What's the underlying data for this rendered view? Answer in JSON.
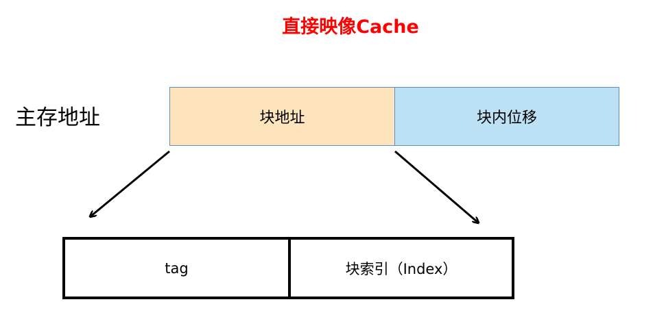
{
  "title": "直接映像Cache",
  "main_memory_address_label": "主存地址",
  "address_fields": {
    "block_address": "块地址",
    "block_offset": "块内位移"
  },
  "cache_fields": {
    "tag": "tag",
    "block_index": "块索引（Index）"
  },
  "colors": {
    "title": "#ff0000",
    "block_address_fill": "#fde4bd",
    "block_offset_fill": "#bde1f4",
    "cell_border": "#5b8fc7",
    "arrow": "#000000"
  }
}
